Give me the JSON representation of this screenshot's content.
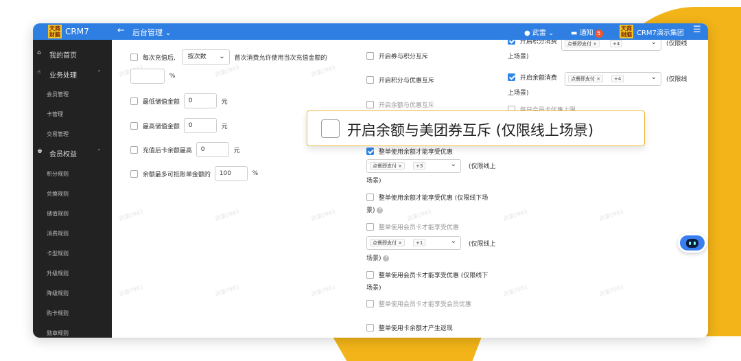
{
  "colors": {
    "accent": "#2f7fe3",
    "sidebar_bg": "#222222",
    "highlight": "#f2b418",
    "badge": "#f3542f"
  },
  "topbar": {
    "logo_text": "天商财脑",
    "app_name": "CRM7",
    "back_icon": "←",
    "breadcrumb": "后台管理",
    "breadcrumb_chevron": "⌄",
    "user": "武雷",
    "user_chevron": "⌄",
    "notify_label": "通知",
    "notify_count": "5",
    "org_name": "CRM7演示集团",
    "menu_icon": "☰"
  },
  "sidebar": {
    "items": [
      {
        "icon": "home-icon",
        "glyph": "⌂",
        "label": "我的首页"
      },
      {
        "icon": "hand-icon",
        "glyph": "☝",
        "label": "业务处理",
        "arrow": "⌃"
      },
      {
        "label": "会员管理"
      },
      {
        "label": "卡管理"
      },
      {
        "label": "交易管理"
      },
      {
        "icon": "thumb-icon",
        "glyph": "♚",
        "label": "会员权益",
        "arrow": "⌃"
      },
      {
        "label": "积分规则"
      },
      {
        "label": "兑换规则"
      },
      {
        "label": "储值规则"
      },
      {
        "label": "消费规则"
      },
      {
        "label": "卡型规则"
      },
      {
        "label": "升级规则"
      },
      {
        "label": "降级规则"
      },
      {
        "label": "购卡规则"
      },
      {
        "label": "勋章规则"
      }
    ]
  },
  "left_col": {
    "recharge_label": "每次充值后,",
    "recharge_select": "按次数",
    "recharge_suffix": "首次消费允许使用当次充值金额的",
    "percent_unit": "%",
    "min_balance_label": "最低储值金额",
    "min_balance_value": "0",
    "max_balance_label": "最高储值金额",
    "max_balance_value": "0",
    "after_recharge_label": "充值后卡余额最高",
    "after_recharge_value": "0",
    "yuan": "元",
    "max_offset_label": "余额最多可抵账单金额的",
    "max_offset_value": "100",
    "max_offset_unit": "%"
  },
  "mid_col": {
    "coupon_points": "开启券与积分互斥",
    "points_discount": "开启积分与优惠互斥",
    "balance_discount": "开启余额与优惠互斥",
    "whole_balance": "整单使用余额才能享受优惠",
    "tag1": "点餐即支付",
    "more1": "+3",
    "online1": "(仅限线上",
    "scene1": "场景)",
    "whole_balance_offline": "整单使用余额才能享受优惠 (仅限线下场",
    "scene_offline1": "景)",
    "whole_member_card": "整单使用会员卡才能享受优惠",
    "tag2": "点餐即支付",
    "more2": "+1",
    "online2": "(仅限线上",
    "scene2": "场景)",
    "whole_member_offline": "整单使用会员卡才能享受优惠 (仅限线下",
    "scene_offline2": "场景)",
    "member_card_member": "整单使用会员卡才能享受会员优惠",
    "card_balance_cashback": "整单使用卡余额才产生返现"
  },
  "right_col": {
    "points_consume_cut": "开启积分消费",
    "tag_r1": "点餐即支付",
    "more_r1": "+4",
    "online_r1_cut": "(仅限线",
    "scene_r1": "上场景)",
    "balance_consume": "开启余额消费",
    "tag_r2": "点餐即支付",
    "more_r2": "+4",
    "online_r2": "(仅限线",
    "scene_r2": "上场景)",
    "daily_limit": "每日会员卡优惠上限"
  },
  "callout": {
    "text": "开启余额与美团券互斥 (仅限线上场景)"
  },
  "watermark": "武雷0983"
}
